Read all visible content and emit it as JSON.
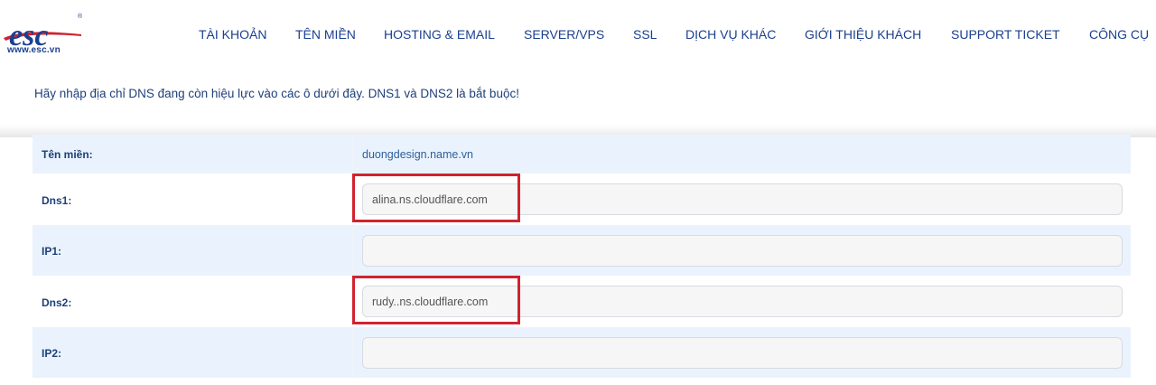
{
  "brand": {
    "logo_text": "esc",
    "url": "www.esc.vn",
    "colors": {
      "primary": "#1b3f8f",
      "accent": "#d0232f"
    }
  },
  "nav": {
    "items": [
      {
        "label": "TÀI KHOẢN"
      },
      {
        "label": "TÊN MIỀN"
      },
      {
        "label": "HOSTING & EMAIL"
      },
      {
        "label": "SERVER/VPS"
      },
      {
        "label": "SSL"
      },
      {
        "label": "DỊCH VỤ KHÁC"
      },
      {
        "label": "GIỚI THIỆU KHÁCH"
      },
      {
        "label": "SUPPORT TICKET"
      },
      {
        "label": "CÔNG CỤ"
      }
    ]
  },
  "notice": "Hãy nhập địa chỉ DNS đang còn hiệu lực vào các ô dưới đây. DNS1 và DNS2 là bắt buộc!",
  "form": {
    "domain_label": "Tên miền:",
    "domain_value": "duongdesign.name.vn",
    "dns1_label": "Dns1:",
    "dns1_value": "alina.ns.cloudflare.com",
    "ip1_label": "IP1:",
    "ip1_value": "",
    "dns2_label": "Dns2:",
    "dns2_value": "rudy..ns.cloudflare.com",
    "ip2_label": "IP2:",
    "ip2_value": ""
  }
}
